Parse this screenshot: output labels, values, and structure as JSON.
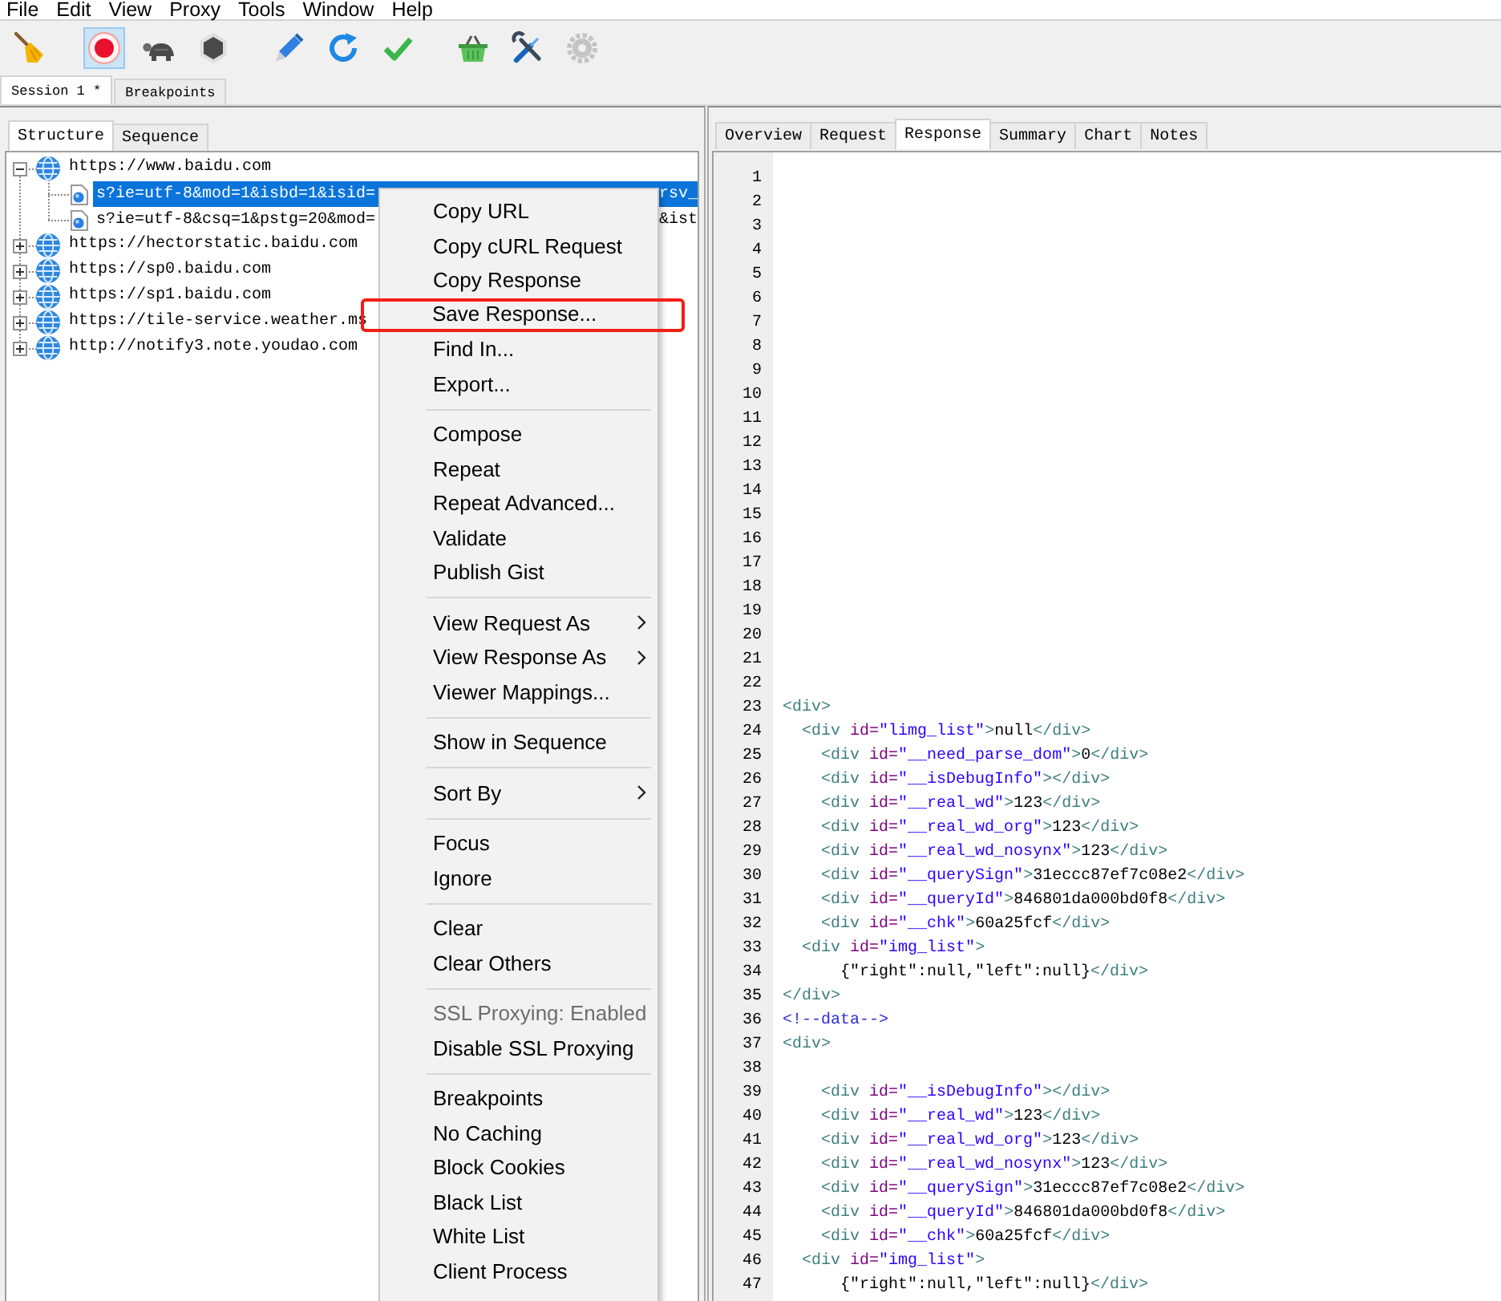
{
  "menu": [
    "File",
    "Edit",
    "View",
    "Proxy",
    "Tools",
    "Window",
    "Help"
  ],
  "toolbar": {
    "groups": [
      [
        {
          "kind": "broom",
          "selected": false,
          "disabled": false
        }
      ],
      [
        {
          "kind": "record",
          "selected": true,
          "disabled": false
        },
        {
          "kind": "turtle",
          "selected": false,
          "disabled": false
        },
        {
          "kind": "stop",
          "selected": false,
          "disabled": false
        }
      ],
      [
        {
          "kind": "pen",
          "selected": false,
          "disabled": false
        },
        {
          "kind": "refresh",
          "selected": false,
          "disabled": false
        },
        {
          "kind": "check",
          "selected": false,
          "disabled": false
        }
      ],
      [
        {
          "kind": "basket",
          "selected": false,
          "disabled": false
        },
        {
          "kind": "tools",
          "selected": false,
          "disabled": false
        },
        {
          "kind": "gear",
          "selected": false,
          "disabled": true
        }
      ]
    ]
  },
  "session_tabs": [
    {
      "label": "Session 1 *",
      "selected": true
    },
    {
      "label": "Breakpoints",
      "selected": false
    }
  ],
  "left_panel": {
    "tabs": [
      {
        "label": "Structure",
        "selected": true
      },
      {
        "label": "Sequence",
        "selected": false
      }
    ],
    "tree": [
      {
        "label": "https://www.baidu.com",
        "expanded": true,
        "selected": false,
        "children": [
          {
            "label": "s?ie=utf-8&mod=1&isbd=1&isid=",
            "label_end": "rsv_",
            "selected": true
          },
          {
            "label": "s?ie=utf-8&csq=1&pstg=20&mod=",
            "label_end": "&ist",
            "selected": false
          }
        ]
      },
      {
        "label": "https://hectorstatic.baidu.com",
        "expanded": false,
        "selected": false
      },
      {
        "label": "https://sp0.baidu.com",
        "expanded": false,
        "selected": false
      },
      {
        "label": "https://sp1.baidu.com",
        "expanded": false,
        "selected": false
      },
      {
        "label": "https://tile-service.weather.ms",
        "expanded": false,
        "selected": false
      },
      {
        "label": "http://notify3.note.youdao.com",
        "expanded": false,
        "selected": false
      }
    ]
  },
  "right_panel": {
    "tabs": [
      {
        "label": "Overview",
        "selected": false
      },
      {
        "label": "Request",
        "selected": false
      },
      {
        "label": "Response",
        "selected": true
      },
      {
        "label": "Summary",
        "selected": false
      },
      {
        "label": "Chart",
        "selected": false
      },
      {
        "label": "Notes",
        "selected": false
      }
    ],
    "code_lines": [
      {
        "number": "1"
      },
      {
        "number": "2"
      },
      {
        "number": "3"
      },
      {
        "number": "4"
      },
      {
        "number": "5"
      },
      {
        "number": "6"
      },
      {
        "number": "7"
      },
      {
        "number": "8"
      },
      {
        "number": "9"
      },
      {
        "number": "10"
      },
      {
        "number": "11"
      },
      {
        "number": "12"
      },
      {
        "number": "13"
      },
      {
        "number": "14"
      },
      {
        "number": "15"
      },
      {
        "number": "16"
      },
      {
        "number": "17"
      },
      {
        "number": "18"
      },
      {
        "number": "19"
      },
      {
        "number": "20"
      },
      {
        "number": "21"
      },
      {
        "number": "22"
      },
      {
        "number": "23",
        "tokens": [
          {
            "kind": "tag",
            "text": "<div>"
          }
        ]
      },
      {
        "number": "24",
        "tokens": [
          {
            "kind": "tag",
            "text": "  <div "
          },
          {
            "kind": "attr",
            "text": "id="
          },
          {
            "kind": "value",
            "text": "\"limg_list\""
          },
          {
            "kind": "tag",
            "text": ">"
          },
          {
            "kind": "text",
            "text": "null"
          },
          {
            "kind": "tag",
            "text": "</div>"
          }
        ]
      },
      {
        "number": "25",
        "tokens": [
          {
            "kind": "tag",
            "text": "    <div "
          },
          {
            "kind": "attr",
            "text": "id="
          },
          {
            "kind": "value",
            "text": "\"__need_parse_dom\""
          },
          {
            "kind": "tag",
            "text": ">"
          },
          {
            "kind": "text",
            "text": "0"
          },
          {
            "kind": "tag",
            "text": "</div>"
          }
        ]
      },
      {
        "number": "26",
        "tokens": [
          {
            "kind": "tag",
            "text": "    <div "
          },
          {
            "kind": "attr",
            "text": "id="
          },
          {
            "kind": "value",
            "text": "\"__isDebugInfo\""
          },
          {
            "kind": "tag",
            "text": "></div>"
          }
        ]
      },
      {
        "number": "27",
        "tokens": [
          {
            "kind": "tag",
            "text": "    <div "
          },
          {
            "kind": "attr",
            "text": "id="
          },
          {
            "kind": "value",
            "text": "\"__real_wd\""
          },
          {
            "kind": "tag",
            "text": ">"
          },
          {
            "kind": "text",
            "text": "123"
          },
          {
            "kind": "tag",
            "text": "</div>"
          }
        ]
      },
      {
        "number": "28",
        "tokens": [
          {
            "kind": "tag",
            "text": "    <div "
          },
          {
            "kind": "attr",
            "text": "id="
          },
          {
            "kind": "value",
            "text": "\"__real_wd_org\""
          },
          {
            "kind": "tag",
            "text": ">"
          },
          {
            "kind": "text",
            "text": "123"
          },
          {
            "kind": "tag",
            "text": "</div>"
          }
        ]
      },
      {
        "number": "29",
        "tokens": [
          {
            "kind": "tag",
            "text": "    <div "
          },
          {
            "kind": "attr",
            "text": "id="
          },
          {
            "kind": "value",
            "text": "\"__real_wd_nosynx\""
          },
          {
            "kind": "tag",
            "text": ">"
          },
          {
            "kind": "text",
            "text": "123"
          },
          {
            "kind": "tag",
            "text": "</div>"
          }
        ]
      },
      {
        "number": "30",
        "tokens": [
          {
            "kind": "tag",
            "text": "    <div "
          },
          {
            "kind": "attr",
            "text": "id="
          },
          {
            "kind": "value",
            "text": "\"__querySign\""
          },
          {
            "kind": "tag",
            "text": ">"
          },
          {
            "kind": "text",
            "text": "31eccc87ef7c08e2"
          },
          {
            "kind": "tag",
            "text": "</div>"
          }
        ]
      },
      {
        "number": "31",
        "tokens": [
          {
            "kind": "tag",
            "text": "    <div "
          },
          {
            "kind": "attr",
            "text": "id="
          },
          {
            "kind": "value",
            "text": "\"__queryId\""
          },
          {
            "kind": "tag",
            "text": ">"
          },
          {
            "kind": "text",
            "text": "846801da000bd0f8"
          },
          {
            "kind": "tag",
            "text": "</div>"
          }
        ]
      },
      {
        "number": "32",
        "tokens": [
          {
            "kind": "tag",
            "text": "    <div "
          },
          {
            "kind": "attr",
            "text": "id="
          },
          {
            "kind": "value",
            "text": "\"__chk\""
          },
          {
            "kind": "tag",
            "text": ">"
          },
          {
            "kind": "text",
            "text": "60a25fcf"
          },
          {
            "kind": "tag",
            "text": "</div>"
          }
        ]
      },
      {
        "number": "33",
        "tokens": [
          {
            "kind": "tag",
            "text": "  <div "
          },
          {
            "kind": "attr",
            "text": "id="
          },
          {
            "kind": "value",
            "text": "\"img_list\""
          },
          {
            "kind": "tag",
            "text": ">"
          }
        ]
      },
      {
        "number": "34",
        "tokens": [
          {
            "kind": "text",
            "text": "      {\"right\":null,\"left\":null}"
          },
          {
            "kind": "tag",
            "text": "</div>"
          }
        ]
      },
      {
        "number": "35",
        "tokens": [
          {
            "kind": "tag",
            "text": "</div>"
          }
        ]
      },
      {
        "number": "36",
        "tokens": [
          {
            "kind": "comment",
            "text": "<!--data-->"
          }
        ]
      },
      {
        "number": "37",
        "tokens": [
          {
            "kind": "tag",
            "text": "<div>"
          }
        ]
      },
      {
        "number": "38"
      },
      {
        "number": "39",
        "tokens": [
          {
            "kind": "tag",
            "text": "    <div "
          },
          {
            "kind": "attr",
            "text": "id="
          },
          {
            "kind": "value",
            "text": "\"__isDebugInfo\""
          },
          {
            "kind": "tag",
            "text": "></div>"
          }
        ]
      },
      {
        "number": "40",
        "tokens": [
          {
            "kind": "tag",
            "text": "    <div "
          },
          {
            "kind": "attr",
            "text": "id="
          },
          {
            "kind": "value",
            "text": "\"__real_wd\""
          },
          {
            "kind": "tag",
            "text": ">"
          },
          {
            "kind": "text",
            "text": "123"
          },
          {
            "kind": "tag",
            "text": "</div>"
          }
        ]
      },
      {
        "number": "41",
        "tokens": [
          {
            "kind": "tag",
            "text": "    <div "
          },
          {
            "kind": "attr",
            "text": "id="
          },
          {
            "kind": "value",
            "text": "\"__real_wd_org\""
          },
          {
            "kind": "tag",
            "text": ">"
          },
          {
            "kind": "text",
            "text": "123"
          },
          {
            "kind": "tag",
            "text": "</div>"
          }
        ]
      },
      {
        "number": "42",
        "tokens": [
          {
            "kind": "tag",
            "text": "    <div "
          },
          {
            "kind": "attr",
            "text": "id="
          },
          {
            "kind": "value",
            "text": "\"__real_wd_nosynx\""
          },
          {
            "kind": "tag",
            "text": ">"
          },
          {
            "kind": "text",
            "text": "123"
          },
          {
            "kind": "tag",
            "text": "</div>"
          }
        ]
      },
      {
        "number": "43",
        "tokens": [
          {
            "kind": "tag",
            "text": "    <div "
          },
          {
            "kind": "attr",
            "text": "id="
          },
          {
            "kind": "value",
            "text": "\"__querySign\""
          },
          {
            "kind": "tag",
            "text": ">"
          },
          {
            "kind": "text",
            "text": "31eccc87ef7c08e2"
          },
          {
            "kind": "tag",
            "text": "</div>"
          }
        ]
      },
      {
        "number": "44",
        "tokens": [
          {
            "kind": "tag",
            "text": "    <div "
          },
          {
            "kind": "attr",
            "text": "id="
          },
          {
            "kind": "value",
            "text": "\"__queryId\""
          },
          {
            "kind": "tag",
            "text": ">"
          },
          {
            "kind": "text",
            "text": "846801da000bd0f8"
          },
          {
            "kind": "tag",
            "text": "</div>"
          }
        ]
      },
      {
        "number": "45",
        "tokens": [
          {
            "kind": "tag",
            "text": "    <div "
          },
          {
            "kind": "attr",
            "text": "id="
          },
          {
            "kind": "value",
            "text": "\"__chk\""
          },
          {
            "kind": "tag",
            "text": ">"
          },
          {
            "kind": "text",
            "text": "60a25fcf"
          },
          {
            "kind": "tag",
            "text": "</div>"
          }
        ]
      },
      {
        "number": "46",
        "tokens": [
          {
            "kind": "tag",
            "text": "  <div "
          },
          {
            "kind": "attr",
            "text": "id="
          },
          {
            "kind": "value",
            "text": "\"img_list\""
          },
          {
            "kind": "tag",
            "text": ">"
          }
        ]
      },
      {
        "number": "47",
        "tokens": [
          {
            "kind": "text",
            "text": "      {\"right\":null,\"left\":null}"
          },
          {
            "kind": "tag",
            "text": "</div>"
          }
        ]
      }
    ]
  },
  "context_menu": {
    "groups": [
      {
        "items": [
          {
            "label": "Copy URL",
            "submenu": false,
            "disabled": false,
            "marked": false
          },
          {
            "label": "Copy cURL Request",
            "submenu": false,
            "disabled": false,
            "marked": false
          },
          {
            "label": "Copy Response",
            "submenu": false,
            "disabled": false,
            "marked": false
          },
          {
            "label": "Save Response...",
            "submenu": false,
            "disabled": false,
            "marked": true
          },
          {
            "label": "Find In...",
            "submenu": false,
            "disabled": false,
            "marked": false
          },
          {
            "label": "Export...",
            "submenu": false,
            "disabled": false,
            "marked": false
          }
        ]
      },
      {
        "items": [
          {
            "label": "Compose",
            "submenu": false,
            "disabled": false,
            "marked": false
          },
          {
            "label": "Repeat",
            "submenu": false,
            "disabled": false,
            "marked": false
          },
          {
            "label": "Repeat Advanced...",
            "submenu": false,
            "disabled": false,
            "marked": false
          },
          {
            "label": "Validate",
            "submenu": false,
            "disabled": false,
            "marked": false
          },
          {
            "label": "Publish Gist",
            "submenu": false,
            "disabled": false,
            "marked": false
          }
        ]
      },
      {
        "items": [
          {
            "label": "View Request As",
            "submenu": true,
            "disabled": false,
            "marked": false
          },
          {
            "label": "View Response As",
            "submenu": true,
            "disabled": false,
            "marked": false
          },
          {
            "label": "Viewer Mappings...",
            "submenu": false,
            "disabled": false,
            "marked": false
          }
        ]
      },
      {
        "items": [
          {
            "label": "Show in Sequence",
            "submenu": false,
            "disabled": false,
            "marked": false
          }
        ]
      },
      {
        "items": [
          {
            "label": "Sort By",
            "submenu": true,
            "disabled": false,
            "marked": false
          }
        ]
      },
      {
        "items": [
          {
            "label": "Focus",
            "submenu": false,
            "disabled": false,
            "marked": false
          },
          {
            "label": "Ignore",
            "submenu": false,
            "disabled": false,
            "marked": false
          }
        ]
      },
      {
        "items": [
          {
            "label": "Clear",
            "submenu": false,
            "disabled": false,
            "marked": false
          },
          {
            "label": "Clear Others",
            "submenu": false,
            "disabled": false,
            "marked": false
          }
        ]
      },
      {
        "items": [
          {
            "label": "SSL Proxying: Enabled",
            "submenu": false,
            "disabled": true,
            "marked": false
          },
          {
            "label": "Disable SSL Proxying",
            "submenu": false,
            "disabled": false,
            "marked": false
          }
        ]
      },
      {
        "items": [
          {
            "label": "Breakpoints",
            "submenu": false,
            "disabled": false,
            "marked": false
          },
          {
            "label": "No Caching",
            "submenu": false,
            "disabled": false,
            "marked": false
          },
          {
            "label": "Block Cookies",
            "submenu": false,
            "disabled": false,
            "marked": false
          },
          {
            "label": "Black List",
            "submenu": false,
            "disabled": false,
            "marked": false
          },
          {
            "label": "White List",
            "submenu": false,
            "disabled": false,
            "marked": false
          },
          {
            "label": "Client Process",
            "submenu": false,
            "disabled": false,
            "marked": false
          }
        ]
      }
    ]
  }
}
